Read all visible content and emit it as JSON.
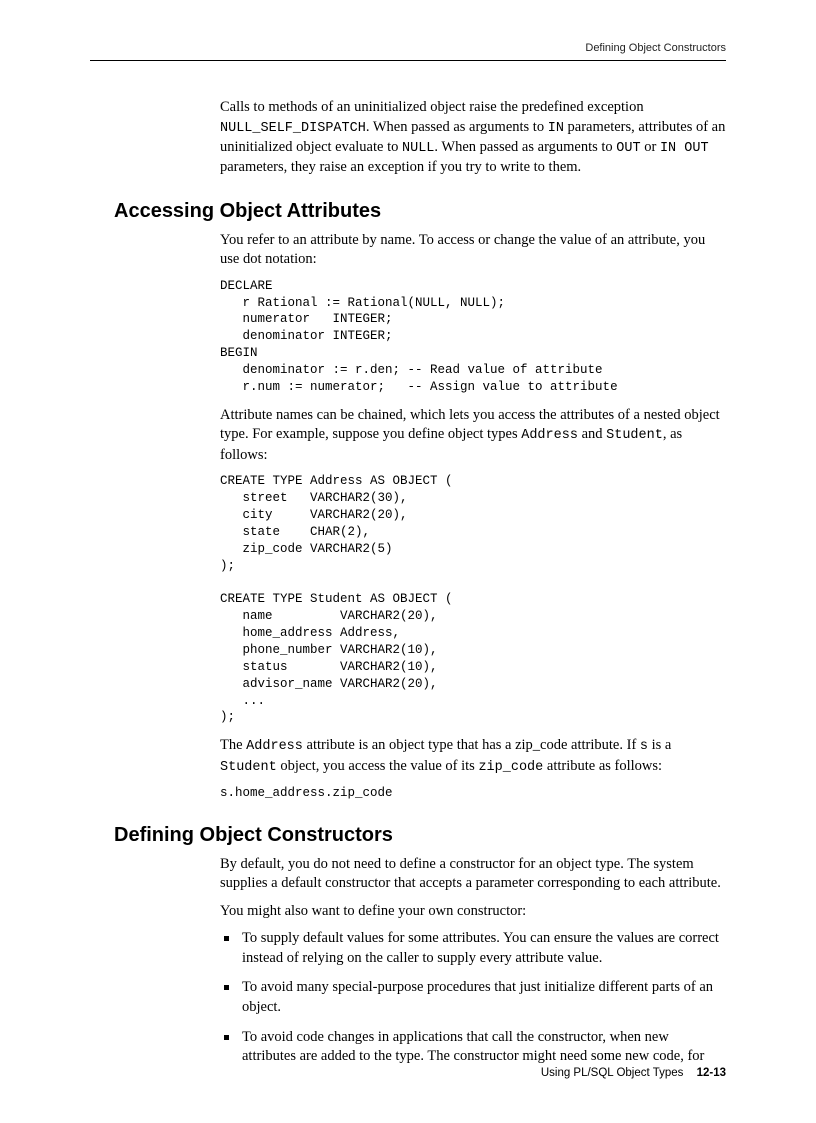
{
  "header": {
    "running_head": "Defining Object Constructors"
  },
  "intro": {
    "p_pre": "Calls to methods of an uninitialized object raise the predefined exception ",
    "code1": "NULL_SELF_DISPATCH",
    "p_mid1": ". When passed as arguments to ",
    "code2": "IN",
    "p_mid2": " parameters, attributes of an uninitialized object evaluate to ",
    "code3": "NULL",
    "p_mid3": ". When passed as arguments to ",
    "code4": "OUT",
    "p_mid4": " or ",
    "code5": "IN OUT",
    "p_end": " parameters, they raise an exception if you try to write to them."
  },
  "section1": {
    "title": "Accessing Object Attributes",
    "p1": "You refer to an attribute by name. To access or change the value of an attribute, you use dot notation:",
    "code1": "DECLARE\n   r Rational := Rational(NULL, NULL);\n   numerator   INTEGER;\n   denominator INTEGER;\nBEGIN\n   denominator := r.den; -- Read value of attribute\n   r.num := numerator;   -- Assign value to attribute",
    "p2_pre": "Attribute names can be chained, which lets you access the attributes of a nested object type. For example, suppose you define object types ",
    "p2_code1": "Address",
    "p2_mid": " and ",
    "p2_code2": "Student",
    "p2_end": ", as follows:",
    "code2": "CREATE TYPE Address AS OBJECT (\n   street   VARCHAR2(30),\n   city     VARCHAR2(20),\n   state    CHAR(2),\n   zip_code VARCHAR2(5)\n);\n\nCREATE TYPE Student AS OBJECT (\n   name         VARCHAR2(20),\n   home_address Address,\n   phone_number VARCHAR2(10),\n   status       VARCHAR2(10),\n   advisor_name VARCHAR2(20),\n   ...\n);",
    "p3_pre": "The ",
    "p3_code1": "Address",
    "p3_mid1": " attribute is an object type that has a zip_code attribute. If ",
    "p3_code2": "s",
    "p3_mid2": " is a ",
    "p3_code3": "Student",
    "p3_mid3": " object, you access the value of its ",
    "p3_code4": "zip_code",
    "p3_end": " attribute as follows:",
    "code3": "s.home_address.zip_code"
  },
  "section2": {
    "title": "Defining Object Constructors",
    "p1": "By default, you do not need to define a constructor for an object type. The system supplies a default constructor that accepts a parameter corresponding to each attribute.",
    "p2": "You might also want to define your own constructor:",
    "bullets": [
      "To supply default values for some attributes. You can ensure the values are correct instead of relying on the caller to supply every attribute value.",
      "To avoid many special-purpose procedures that just initialize different parts of an object.",
      "To avoid code changes in applications that call the constructor, when new attributes are added to the type. The constructor might need some new code, for"
    ]
  },
  "footer": {
    "chapter": "Using PL/SQL Object Types",
    "page_number": "12-13"
  }
}
